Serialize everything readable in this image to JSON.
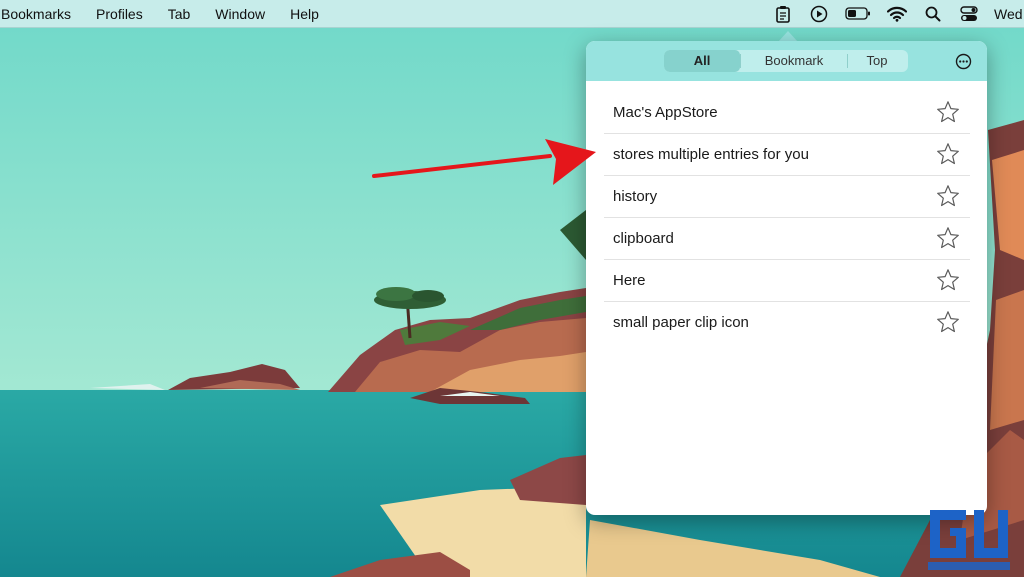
{
  "menubar": {
    "items": [
      "Bookmarks",
      "Profiles",
      "Tab",
      "Window",
      "Help"
    ],
    "clock": "Wed",
    "tray_icons": [
      "clipboard-icon",
      "play-icon",
      "battery-icon",
      "wifi-icon",
      "search-icon",
      "control-center-icon"
    ]
  },
  "panel": {
    "tabs": [
      {
        "label": "All",
        "active": true
      },
      {
        "label": "Bookmark",
        "active": false
      },
      {
        "label": "Top",
        "active": false
      }
    ],
    "more_icon": "ellipsis-circle-icon",
    "entries": [
      {
        "text": "Mac's AppStore",
        "starred": false
      },
      {
        "text": "stores multiple entries for you",
        "starred": false
      },
      {
        "text": "history",
        "starred": false
      },
      {
        "text": "clipboard",
        "starred": false
      },
      {
        "text": "Here",
        "starred": false
      },
      {
        "text": "small paper clip icon",
        "starred": false
      }
    ]
  },
  "annotation": {
    "color": "#e5161b",
    "points_to_entry": 2
  },
  "colors": {
    "menubar": "#c7ecea",
    "panel_header": "#97e3df",
    "segment_active": "#86d2cd",
    "sky": "#84dfcc",
    "sea": "#1e9fa2"
  }
}
